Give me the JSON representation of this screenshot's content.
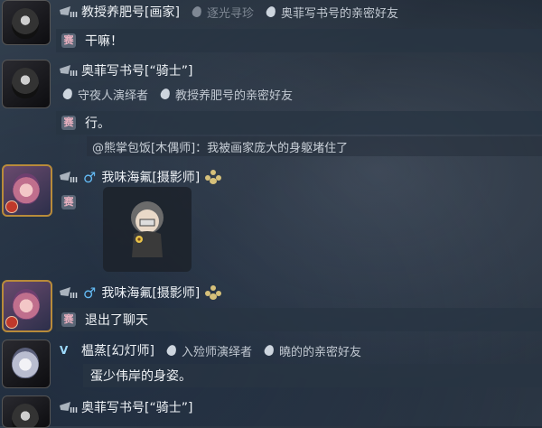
{
  "messages": [
    {
      "name": "教授养肥号[画家]",
      "subs": [
        "逐光寻珍",
        "奥菲写书号的亲密好友"
      ],
      "badge": "赛",
      "text": "干嘛！"
    },
    {
      "name": "奥菲写书号[“骑士”]",
      "subs": [
        "守夜人演绎者",
        "教授养肥号的亲密好友"
      ],
      "badge": "赛",
      "text": "行。",
      "quote": "@熊掌包饭[木偶师]：我被画家庞大的身躯堵住了"
    },
    {
      "name": "我味海氟[摄影师]",
      "badge": "赛",
      "sticker": "sticker"
    },
    {
      "name": "我味海氟[摄影师]",
      "badge": "赛",
      "text": "退出了聊天"
    },
    {
      "name": "榅蒸[幻灯师]",
      "subs": [
        "入殓师演绎者",
        "曉的的亲密好友"
      ],
      "badge": "赛",
      "text": "蛋少伟岸的身姿。"
    },
    {
      "name": "奥菲写书号[“骑士”]"
    }
  ],
  "icons": {
    "rank": "wing-rank-icon",
    "gender": "male-icon",
    "paw": "paw-icon",
    "drop": "water-drop-icon"
  },
  "glyphs": {
    "gender": "♂",
    "rank_bars": "III",
    "v_badge": "V"
  },
  "colors": {
    "background": "#26313e",
    "bubble": "#28343f",
    "male": "#63b9f2",
    "badge_text": "#e9b1c0"
  }
}
